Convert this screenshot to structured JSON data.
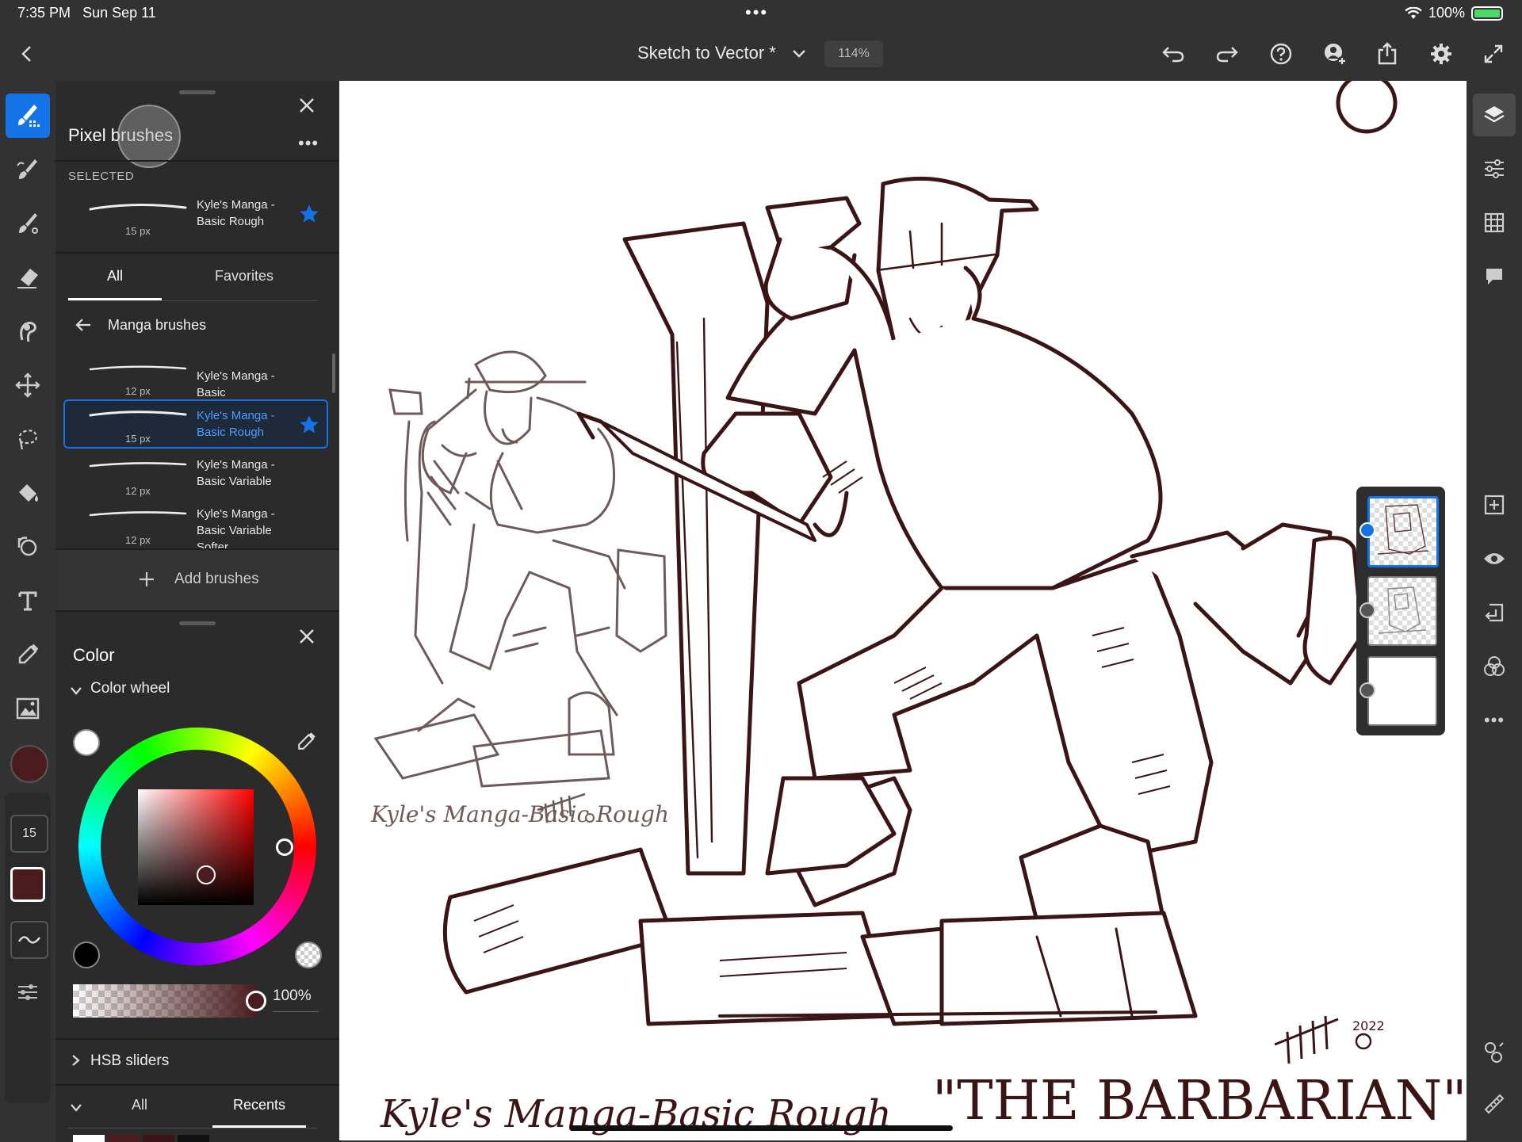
{
  "status_bar": {
    "time": "7:35 PM",
    "date": "Sun Sep 11",
    "battery": "100%"
  },
  "top_bar": {
    "document_title": "Sketch to Vector *",
    "zoom": "114%"
  },
  "brush_panel": {
    "title": "Pixel brushes",
    "selected_label": "SELECTED",
    "selected_brush": {
      "name": "Kyle's Manga - Basic Rough",
      "size": "15 px"
    },
    "tabs": [
      "All",
      "Favorites"
    ],
    "active_tab": "All",
    "category": "Manga brushes",
    "brushes": [
      {
        "name": "Kyle's Manga - Basic",
        "size": "12 px",
        "favorite": false,
        "selected": false
      },
      {
        "name": "Kyle's Manga - Basic Rough",
        "size": "15 px",
        "favorite": true,
        "selected": true
      },
      {
        "name": "Kyle's Manga - Basic Variable",
        "size": "12 px",
        "favorite": false,
        "selected": false
      },
      {
        "name": "Kyle's Manga - Basic Variable Softer",
        "size": "12 px",
        "favorite": false,
        "selected": false
      }
    ],
    "add_label": "Add brushes"
  },
  "color_panel": {
    "title": "Color",
    "section": "Color wheel",
    "opacity": "100%",
    "hsb_label": "HSB sliders",
    "swatch_tabs": [
      "All",
      "Recents"
    ],
    "active_swatch_tab": "Recents",
    "current_color": "#4a1c1e"
  },
  "left_toolbar": {
    "brush_size": "15"
  },
  "canvas": {
    "caption_left": "Kyle's Manga-Basic Rough",
    "caption_right": "\"THE BARBARIAN\"",
    "small_caption": "Kyle's Manga-Basic Rough",
    "signature_year": "2022"
  },
  "colors": {
    "accent": "#1473e6",
    "ink": "#3b1416",
    "sketch": "#6e5a5a"
  }
}
